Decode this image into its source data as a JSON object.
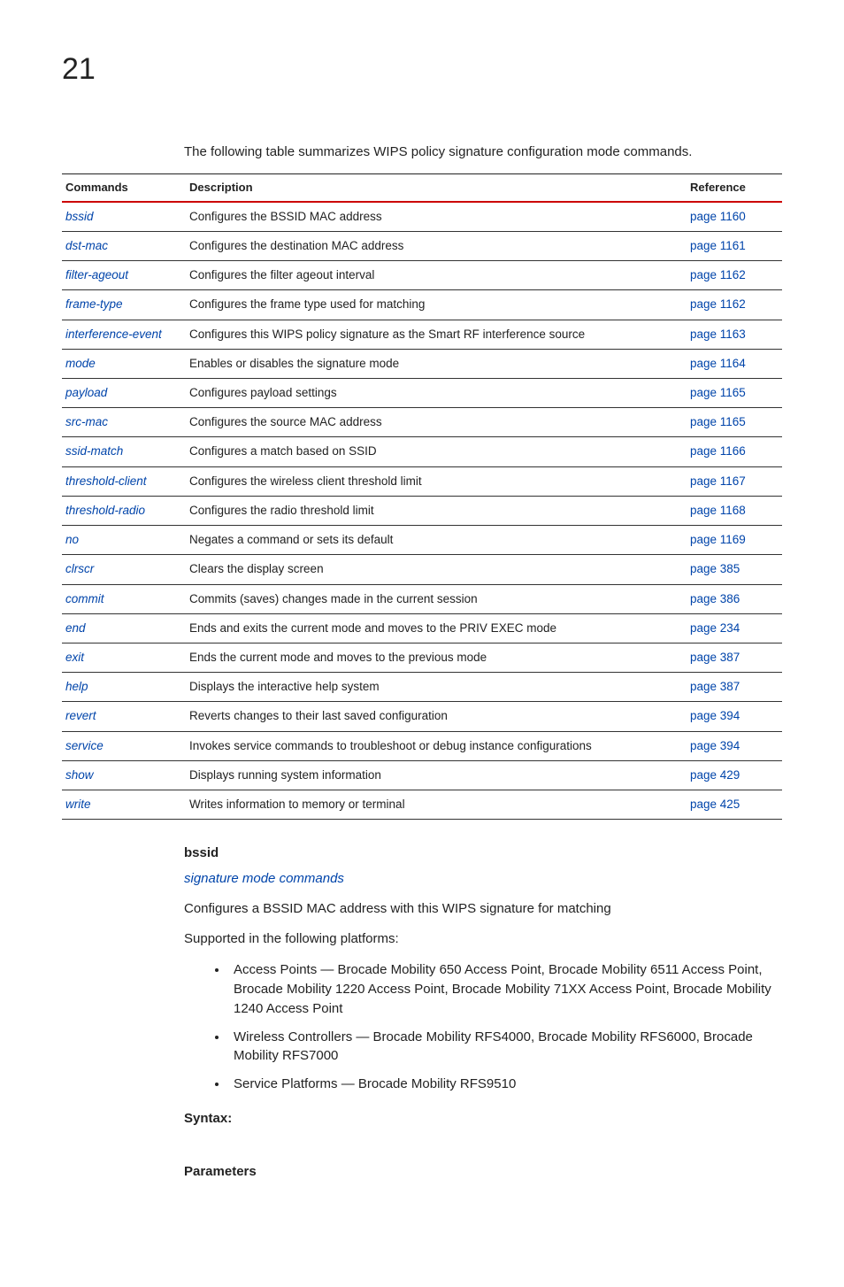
{
  "chapter": "21",
  "intro": "The following table summarizes WIPS policy signature configuration mode commands.",
  "table": {
    "head_cmd": "Commands",
    "head_desc": "Description",
    "head_ref": "Reference",
    "rows": [
      {
        "cmd": "bssid",
        "desc": "Configures the BSSID MAC address",
        "ref": "page 1160"
      },
      {
        "cmd": "dst-mac",
        "desc": "Configures the destination MAC address",
        "ref": "page 1161"
      },
      {
        "cmd": "filter-ageout",
        "desc": "Configures the filter ageout interval",
        "ref": "page 1162"
      },
      {
        "cmd": "frame-type",
        "desc": "Configures the frame type used for matching",
        "ref": "page 1162"
      },
      {
        "cmd": "interference-event",
        "desc": "Configures this WIPS policy signature as the Smart RF interference source",
        "ref": "page 1163"
      },
      {
        "cmd": "mode",
        "desc": "Enables or disables the signature mode",
        "ref": "page 1164"
      },
      {
        "cmd": "payload",
        "desc": "Configures payload settings",
        "ref": "page 1165"
      },
      {
        "cmd": "src-mac",
        "desc": "Configures the source MAC address",
        "ref": "page 1165"
      },
      {
        "cmd": "ssid-match",
        "desc": "Configures a match based on SSID",
        "ref": "page 1166"
      },
      {
        "cmd": "threshold-client",
        "desc": "Configures the wireless client threshold limit",
        "ref": "page 1167"
      },
      {
        "cmd": "threshold-radio",
        "desc": "Configures the radio threshold limit",
        "ref": "page 1168"
      },
      {
        "cmd": "no",
        "desc": "Negates a command or sets its default",
        "ref": "page 1169"
      },
      {
        "cmd": "clrscr",
        "desc": "Clears the display screen",
        "ref": "page 385"
      },
      {
        "cmd": "commit",
        "desc": "Commits (saves) changes made in the current session",
        "ref": "page 386"
      },
      {
        "cmd": "end",
        "desc": "Ends and exits the current mode and moves to the PRIV EXEC mode",
        "ref": "page 234"
      },
      {
        "cmd": "exit",
        "desc": "Ends the current mode and moves to the previous mode",
        "ref": "page 387"
      },
      {
        "cmd": "help",
        "desc": "Displays the interactive help system",
        "ref": "page 387"
      },
      {
        "cmd": "revert",
        "desc": "Reverts changes to their last saved configuration",
        "ref": "page 394"
      },
      {
        "cmd": "service",
        "desc": "Invokes service commands to troubleshoot or debug instance configurations",
        "ref": "page 394"
      },
      {
        "cmd": "show",
        "desc": "Displays running system information",
        "ref": "page 429"
      },
      {
        "cmd": "write",
        "desc": "Writes information to memory or terminal",
        "ref": "page 425"
      }
    ]
  },
  "section": {
    "title": "bssid",
    "link": "signature mode commands",
    "para1": "Configures a BSSID MAC address with this WIPS signature for matching",
    "para2": "Supported in the following platforms:",
    "bullets": [
      "Access Points — Brocade Mobility 650 Access Point, Brocade Mobility 6511 Access Point, Brocade Mobility 1220 Access Point, Brocade Mobility 71XX Access Point, Brocade Mobility 1240 Access Point",
      "Wireless Controllers — Brocade Mobility RFS4000, Brocade Mobility RFS6000, Brocade Mobility RFS7000",
      "Service Platforms — Brocade Mobility RFS9510"
    ],
    "syntax_label": "Syntax:",
    "params_label": "Parameters"
  }
}
